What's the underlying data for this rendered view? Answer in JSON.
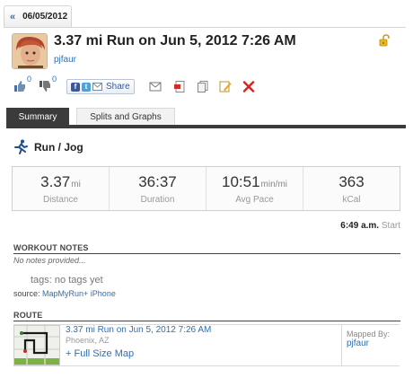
{
  "header": {
    "date_tab": "06/05/2012",
    "back_glyph": "«",
    "title": "3.37 mi Run on Jun 5, 2012 7:26 AM",
    "username": "pjfaur"
  },
  "social": {
    "likes": "0",
    "dislikes": "0",
    "share_label": "Share"
  },
  "tabs": [
    {
      "label": "Summary",
      "active": true
    },
    {
      "label": "Splits and Graphs",
      "active": false
    }
  ],
  "activity": {
    "type": "Run / Jog"
  },
  "stats": [
    {
      "value": "3.37",
      "unit": "mi",
      "label": "Distance"
    },
    {
      "value": "36:37",
      "unit": "",
      "label": "Duration"
    },
    {
      "value": "10:51",
      "unit": "min/mi",
      "label": "Avg Pace"
    },
    {
      "value": "363",
      "unit": "",
      "label": "kCal"
    }
  ],
  "start": {
    "time": "6:49 a.m.",
    "label": "Start"
  },
  "notes": {
    "heading": "WORKOUT NOTES",
    "text": "No notes provided...",
    "tags": "tags: no tags yet",
    "source_label": "source:",
    "source_link": "MapMyRun+ iPhone"
  },
  "route": {
    "heading": "ROUTE",
    "title": "3.37 mi Run on Jun 5, 2012 7:26 AM",
    "location": "Phoenix, AZ",
    "map_link": "+ Full Size Map",
    "mapped_by_label": "Mapped By:",
    "mapped_by_user": "pjfaur"
  },
  "colors": {
    "link": "#2f6fb3",
    "tab_dark": "#3b3b3b",
    "route_line": "#1a1a1a"
  },
  "icons": [
    "lock-icon",
    "thumbs-up-icon",
    "thumbs-down-icon",
    "facebook-icon",
    "twitter-icon",
    "email-icon",
    "pdf-icon",
    "copy-icon",
    "edit-icon",
    "delete-icon",
    "runner-icon"
  ]
}
